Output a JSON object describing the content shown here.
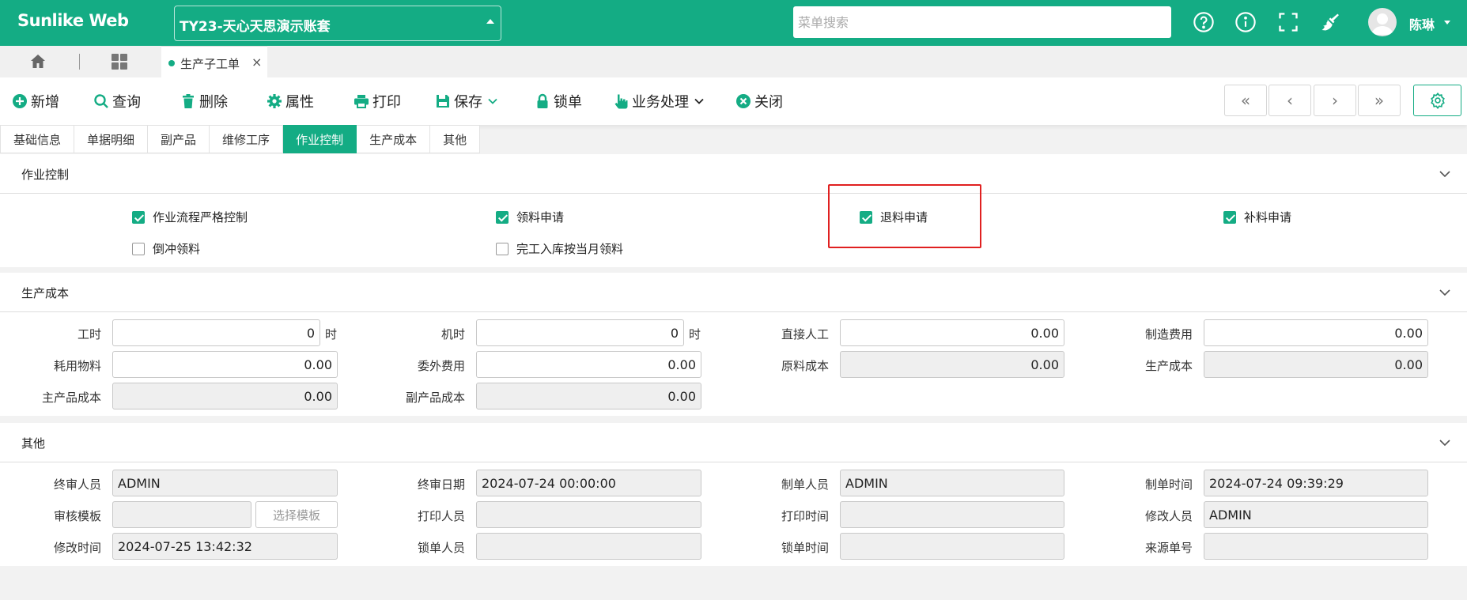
{
  "header": {
    "logo": "Sunlike Web",
    "account": "TY23-天心天思演示账套",
    "search_placeholder": "菜单搜索",
    "user_name": "陈琳"
  },
  "tabbar": {
    "doc_tab": "生产子工单",
    "close": "×"
  },
  "toolbar": {
    "new": "新增",
    "query": "查询",
    "delete": "删除",
    "properties": "属性",
    "print": "打印",
    "save": "保存",
    "lock": "锁单",
    "business": "业务处理",
    "close": "关闭",
    "first": "«",
    "prev": "‹",
    "next": "›",
    "last": "»"
  },
  "section_tabs": [
    "基础信息",
    "单据明细",
    "副产品",
    "维修工序",
    "作业控制",
    "生产成本",
    "其他"
  ],
  "active_tab": "作业控制",
  "control": {
    "title": "作业控制",
    "items": [
      {
        "label": "作业流程严格控制",
        "checked": true
      },
      {
        "label": "领料申请",
        "checked": true
      },
      {
        "label": "退料申请",
        "checked": true
      },
      {
        "label": "补料申请",
        "checked": true
      },
      {
        "label": "倒冲领料",
        "checked": false
      },
      {
        "label": "完工入库按当月领料",
        "checked": false
      }
    ]
  },
  "cost": {
    "title": "生产成本",
    "labor_hours_label": "工时",
    "labor_hours": "0",
    "labor_hours_unit": "时",
    "machine_hours_label": "机时",
    "machine_hours": "0",
    "machine_hours_unit": "时",
    "direct_labor_label": "直接人工",
    "direct_labor": "0.00",
    "manufacturing_label": "制造费用",
    "manufacturing": "0.00",
    "consumables_label": "耗用物料",
    "consumables": "0.00",
    "outsourcing_label": "委外费用",
    "outsourcing": "0.00",
    "raw_material_label": "原料成本",
    "raw_material": "0.00",
    "production_cost_label": "生产成本",
    "production_cost": "0.00",
    "main_product_label": "主产品成本",
    "main_product": "0.00",
    "by_product_label": "副产品成本",
    "by_product": "0.00"
  },
  "other": {
    "title": "其他",
    "final_reviewer_label": "终审人员",
    "final_reviewer": "ADMIN",
    "final_review_date_label": "终审日期",
    "final_review_date": "2024-07-24 00:00:00",
    "creator_label": "制单人员",
    "creator": "ADMIN",
    "create_time_label": "制单时间",
    "create_time": "2024-07-24 09:39:29",
    "review_template_label": "审核模板",
    "review_template": "",
    "select_template": "选择模板",
    "printer_label": "打印人员",
    "printer": "",
    "print_time_label": "打印时间",
    "print_time": "",
    "modifier_label": "修改人员",
    "modifier": "ADMIN",
    "modify_time_label": "修改时间",
    "modify_time": "2024-07-25 13:42:32",
    "locker_label": "锁单人员",
    "locker": "",
    "lock_time_label": "锁单时间",
    "lock_time": "",
    "source_no_label": "来源单号",
    "source_no": ""
  },
  "colors": {
    "primary": "#14ac84",
    "highlight": "#e02020"
  }
}
